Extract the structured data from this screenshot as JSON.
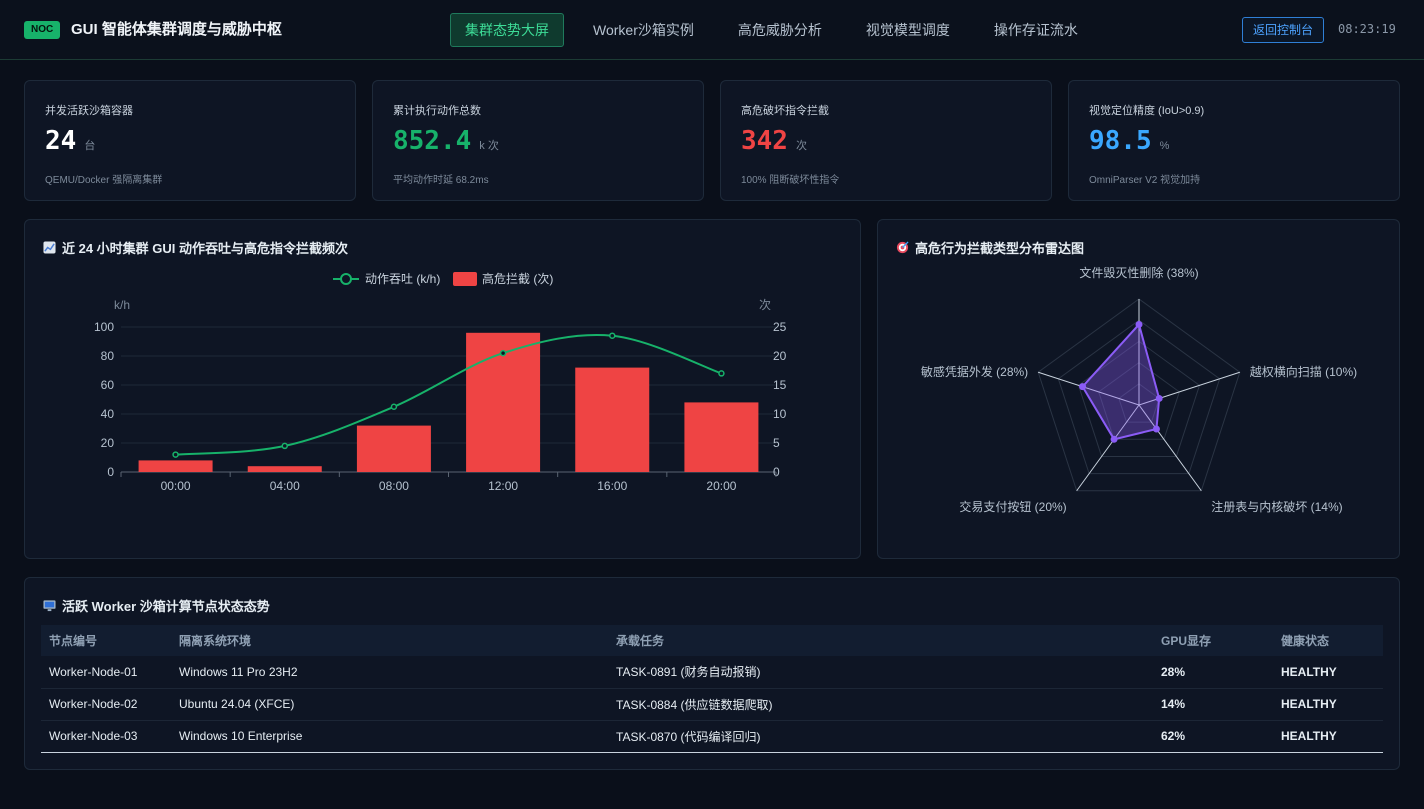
{
  "header": {
    "badge": "NOC",
    "title": "GUI 智能体集群调度与威胁中枢",
    "tabs": [
      {
        "label": "集群态势大屏",
        "active": true
      },
      {
        "label": "Worker沙箱实例",
        "active": false
      },
      {
        "label": "高危威胁分析",
        "active": false
      },
      {
        "label": "视觉模型调度",
        "active": false
      },
      {
        "label": "操作存证流水",
        "active": false
      }
    ],
    "console_button": "返回控制台",
    "time": "08:23:19"
  },
  "kpis": [
    {
      "label": "并发活跃沙箱容器",
      "value": "24",
      "unit": "台",
      "sub": "QEMU/Docker 强隔离集群",
      "color": "#ffffff"
    },
    {
      "label": "累计执行动作总数",
      "value": "852.4",
      "unit": "k 次",
      "sub": "平均动作时延 68.2ms",
      "color": "#17b26a"
    },
    {
      "label": "高危破坏指令拦截",
      "value": "342",
      "unit": "次",
      "sub": "100% 阻断破坏性指令",
      "color": "#f04444"
    },
    {
      "label": "视觉定位精度 (IoU>0.9)",
      "value": "98.5",
      "unit": "%",
      "sub": "OmniParser V2 视觉加持",
      "color": "#3aa8ff"
    }
  ],
  "throughput_panel": {
    "title": "近 24 小时集群 GUI 动作吞吐与高危指令拦截频次"
  },
  "radar_panel": {
    "title": "高危行为拦截类型分布雷达图"
  },
  "nodes_panel": {
    "title": "活跃 Worker 沙箱计算节点状态态势"
  },
  "colors": {
    "accent": "#17b26a",
    "danger": "#ef4444",
    "info": "#3aa8ff",
    "radar": "#8b5cf6"
  },
  "chart_data": [
    {
      "type": "bar",
      "categories": [
        "00:00",
        "04:00",
        "08:00",
        "12:00",
        "16:00",
        "20:00"
      ],
      "series": [
        {
          "name": "动作吞吐 (k/h)",
          "type": "line",
          "axis": "left",
          "values": [
            12,
            18,
            45,
            82,
            94,
            68
          ],
          "color": "#17b26a"
        },
        {
          "name": "高危拦截 (次)",
          "type": "bar",
          "axis": "right",
          "values": [
            2,
            1,
            8,
            24,
            18,
            12
          ],
          "color": "#ef4444"
        }
      ],
      "ylabel": "k/h",
      "y2label": "次",
      "ylim": [
        0,
        100
      ],
      "y2lim": [
        0,
        25
      ],
      "yticks": [
        0,
        20,
        40,
        60,
        80,
        100
      ],
      "y2ticks": [
        0,
        5,
        10,
        15,
        20,
        25
      ],
      "grid": true,
      "legend": "top-center"
    },
    {
      "type": "radar",
      "indicators": [
        "文件毁灭性删除 (38%)",
        "越权横向扫描 (10%)",
        "注册表与内核破坏 (14%)",
        "交易支付按钮 (20%)",
        "敏感凭据外发 (28%)"
      ],
      "values": [
        38,
        10,
        14,
        20,
        28
      ],
      "max": 50,
      "color": "#8b5cf6"
    }
  ],
  "nodes_table": {
    "columns": [
      "节点编号",
      "隔离系统环境",
      "承载任务",
      "GPU显存",
      "健康状态"
    ],
    "rows": [
      [
        "Worker-Node-01",
        "Windows 11 Pro 23H2",
        "TASK-0891 (财务自动报销)",
        "28%",
        "HEALTHY"
      ],
      [
        "Worker-Node-02",
        "Ubuntu 24.04 (XFCE)",
        "TASK-0884 (供应链数据爬取)",
        "14%",
        "HEALTHY"
      ],
      [
        "Worker-Node-03",
        "Windows 10 Enterprise",
        "TASK-0870 (代码编译回归)",
        "62%",
        "HEALTHY"
      ]
    ]
  }
}
